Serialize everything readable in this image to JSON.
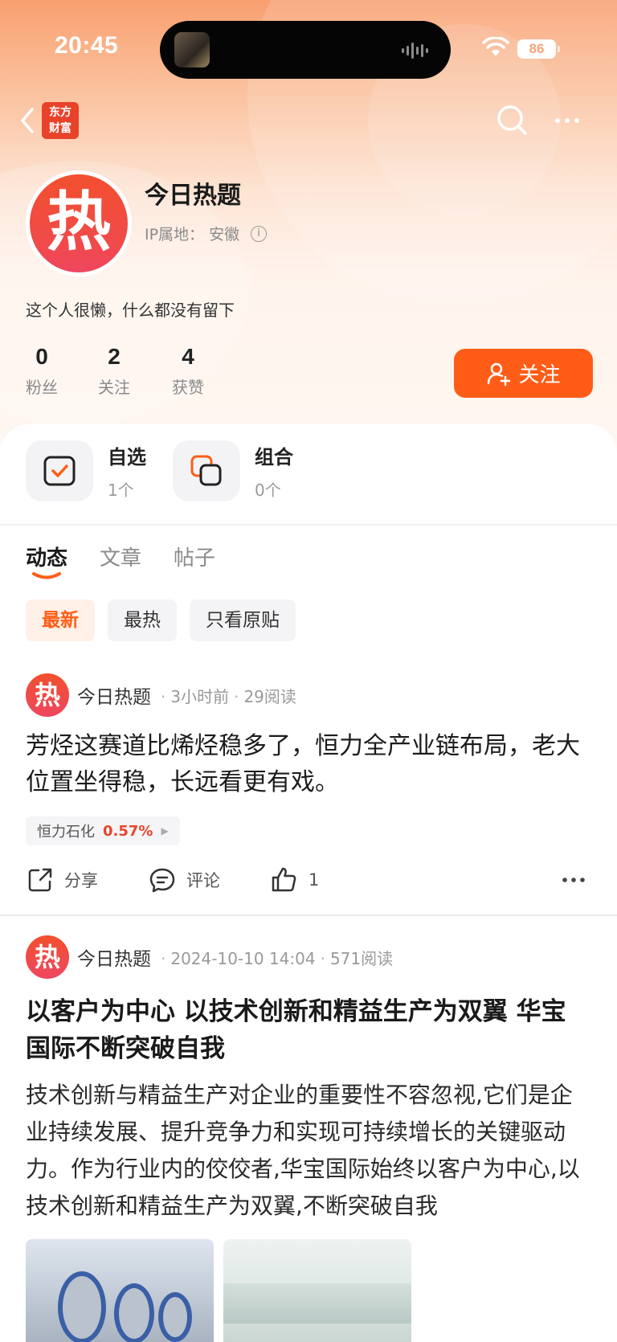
{
  "status": {
    "time": "20:45",
    "battery": "86"
  },
  "nav": {
    "brand_line1": "东方",
    "brand_line2": "财富"
  },
  "profile": {
    "avatar_char": "热",
    "name": "今日热题",
    "ip_label": "IP属地：",
    "ip_value": "安徽",
    "bio": "这个人很懒，什么都没有留下",
    "stats": [
      {
        "value": "0",
        "label": "粉丝"
      },
      {
        "value": "2",
        "label": "关注"
      },
      {
        "value": "4",
        "label": "获赞"
      }
    ],
    "follow_label": "关注"
  },
  "quick": [
    {
      "title": "自选",
      "sub": "1个"
    },
    {
      "title": "组合",
      "sub": "0个"
    }
  ],
  "tabs": [
    "动态",
    "文章",
    "帖子"
  ],
  "filters": [
    "最新",
    "最热",
    "只看原贴"
  ],
  "posts": [
    {
      "author": "今日热题",
      "time": "3小时前",
      "reads": "29阅读",
      "text": "芳烃这赛道比烯烃稳多了，恒力全产业链布局，老大位置坐得稳，长远看更有戏。",
      "stock_name": "恒力石化",
      "stock_change": "0.57%",
      "share_label": "分享",
      "comment_label": "评论",
      "like_count": "1"
    },
    {
      "author": "今日热题",
      "time": "2024-10-10 14:04",
      "reads": "571阅读",
      "title": "以客户为中心 以技术创新和精益生产为双翼 华宝国际不断突破自我",
      "body": "技术创新与精益生产对企业的重要性不容忽视,它们是企业持续发展、提升竞争力和实现可持续增长的关键驱动力。作为行业内的佼佼者,华宝国际始终以客户为中心,以技术创新和精益生产为双翼,不断突破自我"
    }
  ],
  "colors": {
    "accent": "#ff5d17",
    "stock_up": "#e8452c"
  }
}
